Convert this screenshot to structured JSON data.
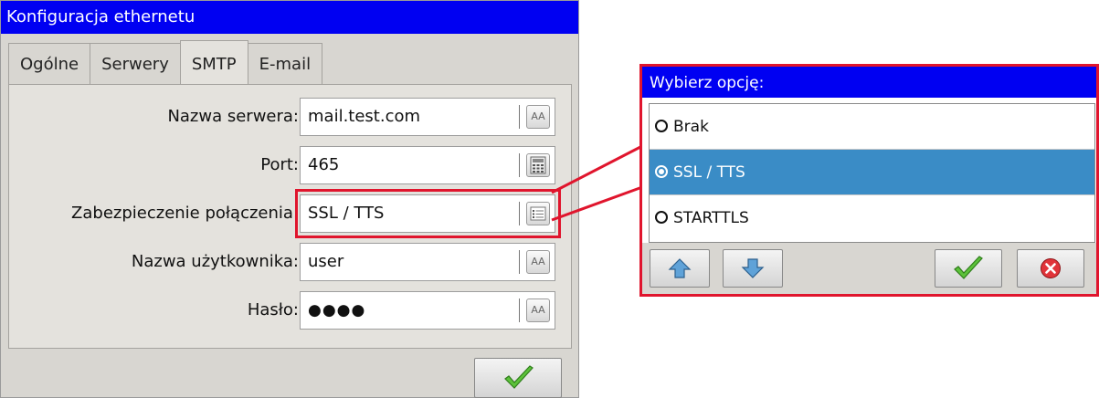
{
  "window": {
    "title": "Konfiguracja ethernetu"
  },
  "tabs": [
    {
      "label": "Ogólne",
      "active": false
    },
    {
      "label": "Serwery",
      "active": false
    },
    {
      "label": "SMTP",
      "active": true
    },
    {
      "label": "E-mail",
      "active": false
    }
  ],
  "form": {
    "server_name": {
      "label": "Nazwa serwera:",
      "value": "mail.test.com",
      "button_icon": "keyboard-icon",
      "button_glyph": "AA"
    },
    "port": {
      "label": "Port:",
      "value": "465",
      "button_icon": "numpad-icon"
    },
    "security": {
      "label": "Zabezpieczenie połączenia:",
      "value": "SSL / TTS",
      "button_icon": "list-icon"
    },
    "username": {
      "label": "Nazwa użytkownika:",
      "value": "user",
      "button_icon": "keyboard-icon",
      "button_glyph": "AA"
    },
    "password": {
      "label": "Hasło:",
      "value": "●●●●",
      "button_icon": "keyboard-icon",
      "button_glyph": "AA"
    }
  },
  "footer": {
    "confirm_icon": "checkmark-icon"
  },
  "popup": {
    "title": "Wybierz opcję:",
    "options": [
      {
        "label": "Brak",
        "selected": false
      },
      {
        "label": "SSL / TTS",
        "selected": true
      },
      {
        "label": "STARTTLS",
        "selected": false
      }
    ],
    "buttons": [
      "arrow-up-icon",
      "arrow-down-icon",
      "checkmark-icon",
      "cancel-icon"
    ]
  },
  "colors": {
    "title_bar": "#0000f2",
    "highlight": "#e0152d",
    "selected_option": "#3a8cc6",
    "background": "#d8d6d1"
  }
}
